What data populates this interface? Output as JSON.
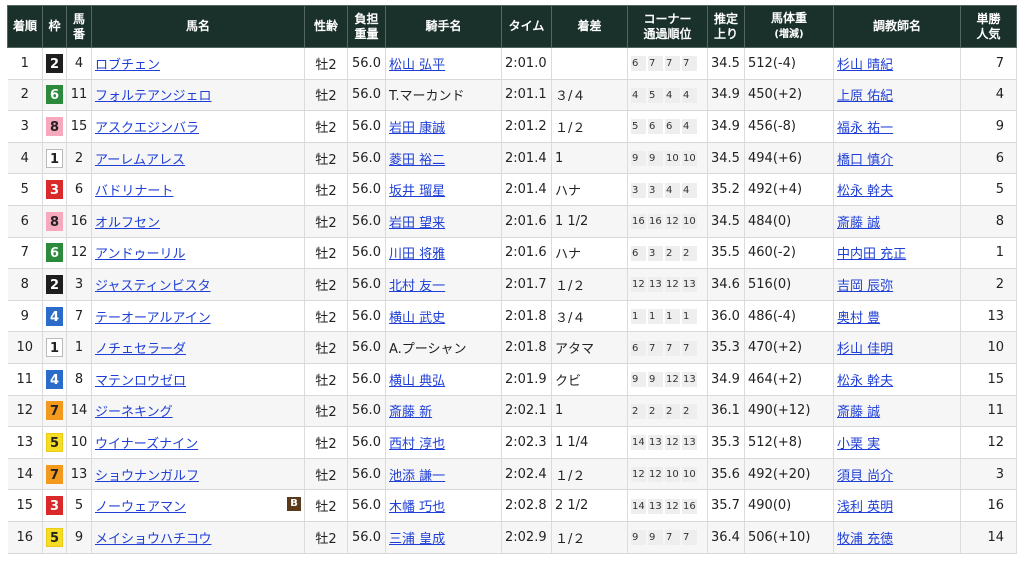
{
  "headers": {
    "rank": "着順",
    "waku": "枠",
    "umaban": [
      "馬",
      "番"
    ],
    "horse": "馬名",
    "sexage": "性齢",
    "weight": [
      "負担",
      "重量"
    ],
    "jockey": "騎手名",
    "time": "タイム",
    "margin": "着差",
    "corner": [
      "コーナー",
      "通過順位"
    ],
    "last3f": [
      "推定",
      "上り"
    ],
    "bodyweight": [
      "馬体重",
      "(増減)"
    ],
    "trainer": "調教師名",
    "pop": [
      "単勝",
      "人気"
    ]
  },
  "blinker_label": "B",
  "rows": [
    {
      "rank": "1",
      "waku": "2",
      "umaban": "4",
      "horse": "ロブチェン",
      "sexage": "牡2",
      "weight": "56.0",
      "jockey": "松山 弘平",
      "jockey_link": true,
      "time": "2:01.0",
      "margin": "",
      "corner": [
        "6",
        "7",
        "7",
        "7"
      ],
      "last3f": "34.5",
      "bodyweight": "512(-4)",
      "trainer": "杉山 晴紀",
      "pop": "7",
      "blinker": false
    },
    {
      "rank": "2",
      "waku": "6",
      "umaban": "11",
      "horse": "フォルテアンジェロ",
      "sexage": "牡2",
      "weight": "56.0",
      "jockey": "T.マーカンド",
      "jockey_link": false,
      "time": "2:01.1",
      "margin": "３/４",
      "corner": [
        "4",
        "5",
        "4",
        "4"
      ],
      "last3f": "34.9",
      "bodyweight": "450(+2)",
      "trainer": "上原 佑紀",
      "pop": "4",
      "blinker": false
    },
    {
      "rank": "3",
      "waku": "8",
      "umaban": "15",
      "horse": "アスクエジンバラ",
      "sexage": "牡2",
      "weight": "56.0",
      "jockey": "岩田 康誠",
      "jockey_link": true,
      "time": "2:01.2",
      "margin": "１/２",
      "corner": [
        "5",
        "6",
        "6",
        "4"
      ],
      "last3f": "34.9",
      "bodyweight": "456(-8)",
      "trainer": "福永 祐一",
      "pop": "9",
      "blinker": false
    },
    {
      "rank": "4",
      "waku": "1",
      "umaban": "2",
      "horse": "アーレムアレス",
      "sexage": "牡2",
      "weight": "56.0",
      "jockey": "菱田 裕二",
      "jockey_link": true,
      "time": "2:01.4",
      "margin": "1",
      "corner": [
        "9",
        "9",
        "10",
        "10"
      ],
      "last3f": "34.5",
      "bodyweight": "494(+6)",
      "trainer": "橋口 慎介",
      "pop": "6",
      "blinker": false
    },
    {
      "rank": "5",
      "waku": "3",
      "umaban": "6",
      "horse": "バドリナート",
      "sexage": "牡2",
      "weight": "56.0",
      "jockey": "坂井 瑠星",
      "jockey_link": true,
      "time": "2:01.4",
      "margin": "ハナ",
      "corner": [
        "3",
        "3",
        "4",
        "4"
      ],
      "last3f": "35.2",
      "bodyweight": "492(+4)",
      "trainer": "松永 幹夫",
      "pop": "5",
      "blinker": false
    },
    {
      "rank": "6",
      "waku": "8",
      "umaban": "16",
      "horse": "オルフセン",
      "sexage": "牡2",
      "weight": "56.0",
      "jockey": "岩田 望来",
      "jockey_link": true,
      "time": "2:01.6",
      "margin": "1 1/2",
      "corner": [
        "16",
        "16",
        "12",
        "10"
      ],
      "last3f": "34.5",
      "bodyweight": "484(0)",
      "trainer": "斎藤 誠",
      "pop": "8",
      "blinker": false
    },
    {
      "rank": "7",
      "waku": "6",
      "umaban": "12",
      "horse": "アンドゥーリル",
      "sexage": "牡2",
      "weight": "56.0",
      "jockey": "川田 将雅",
      "jockey_link": true,
      "time": "2:01.6",
      "margin": "ハナ",
      "corner": [
        "6",
        "3",
        "2",
        "2"
      ],
      "last3f": "35.5",
      "bodyweight": "460(-2)",
      "trainer": "中内田 充正",
      "pop": "1",
      "blinker": false
    },
    {
      "rank": "8",
      "waku": "2",
      "umaban": "3",
      "horse": "ジャスティンビスタ",
      "sexage": "牡2",
      "weight": "56.0",
      "jockey": "北村 友一",
      "jockey_link": true,
      "time": "2:01.7",
      "margin": "１/２",
      "corner": [
        "12",
        "13",
        "12",
        "13"
      ],
      "last3f": "34.6",
      "bodyweight": "516(0)",
      "trainer": "吉岡 辰弥",
      "pop": "2",
      "blinker": false
    },
    {
      "rank": "9",
      "waku": "4",
      "umaban": "7",
      "horse": "テーオーアルアイン",
      "sexage": "牡2",
      "weight": "56.0",
      "jockey": "横山 武史",
      "jockey_link": true,
      "time": "2:01.8",
      "margin": "３/４",
      "corner": [
        "1",
        "1",
        "1",
        "1"
      ],
      "last3f": "36.0",
      "bodyweight": "486(-4)",
      "trainer": "奥村 豊",
      "pop": "13",
      "blinker": false
    },
    {
      "rank": "10",
      "waku": "1",
      "umaban": "1",
      "horse": "ノチェセラーダ",
      "sexage": "牡2",
      "weight": "56.0",
      "jockey": "A.プーシャン",
      "jockey_link": false,
      "time": "2:01.8",
      "margin": "アタマ",
      "corner": [
        "6",
        "7",
        "7",
        "7"
      ],
      "last3f": "35.3",
      "bodyweight": "470(+2)",
      "trainer": "杉山 佳明",
      "pop": "10",
      "blinker": false
    },
    {
      "rank": "11",
      "waku": "4",
      "umaban": "8",
      "horse": "マテンロウゼロ",
      "sexage": "牡2",
      "weight": "56.0",
      "jockey": "横山 典弘",
      "jockey_link": true,
      "time": "2:01.9",
      "margin": "クビ",
      "corner": [
        "9",
        "9",
        "12",
        "13"
      ],
      "last3f": "34.9",
      "bodyweight": "464(+2)",
      "trainer": "松永 幹夫",
      "pop": "15",
      "blinker": false
    },
    {
      "rank": "12",
      "waku": "7",
      "umaban": "14",
      "horse": "ジーネキング",
      "sexage": "牡2",
      "weight": "56.0",
      "jockey": "斎藤 新",
      "jockey_link": true,
      "time": "2:02.1",
      "margin": "1",
      "corner": [
        "2",
        "2",
        "2",
        "2"
      ],
      "last3f": "36.1",
      "bodyweight": "490(+12)",
      "trainer": "斎藤 誠",
      "pop": "11",
      "blinker": false
    },
    {
      "rank": "13",
      "waku": "5",
      "umaban": "10",
      "horse": "ウイナーズナイン",
      "sexage": "牡2",
      "weight": "56.0",
      "jockey": "西村 淳也",
      "jockey_link": true,
      "time": "2:02.3",
      "margin": "1 1/4",
      "corner": [
        "14",
        "13",
        "12",
        "13"
      ],
      "last3f": "35.3",
      "bodyweight": "512(+8)",
      "trainer": "小栗 実",
      "pop": "12",
      "blinker": false
    },
    {
      "rank": "14",
      "waku": "7",
      "umaban": "13",
      "horse": "ショウナンガルフ",
      "sexage": "牡2",
      "weight": "56.0",
      "jockey": "池添 謙一",
      "jockey_link": true,
      "time": "2:02.4",
      "margin": "１/２",
      "corner": [
        "12",
        "12",
        "10",
        "10"
      ],
      "last3f": "35.6",
      "bodyweight": "492(+20)",
      "trainer": "須貝 尚介",
      "pop": "3",
      "blinker": false
    },
    {
      "rank": "15",
      "waku": "3",
      "umaban": "5",
      "horse": "ノーウェアマン",
      "sexage": "牡2",
      "weight": "56.0",
      "jockey": "木幡 巧也",
      "jockey_link": true,
      "time": "2:02.8",
      "margin": "2 1/2",
      "corner": [
        "14",
        "13",
        "12",
        "16"
      ],
      "last3f": "35.7",
      "bodyweight": "490(0)",
      "trainer": "浅利 英明",
      "pop": "16",
      "blinker": true
    },
    {
      "rank": "16",
      "waku": "5",
      "umaban": "9",
      "horse": "メイショウハチコウ",
      "sexage": "牡2",
      "weight": "56.0",
      "jockey": "三浦 皇成",
      "jockey_link": true,
      "time": "2:02.9",
      "margin": "１/２",
      "corner": [
        "9",
        "9",
        "7",
        "7"
      ],
      "last3f": "36.4",
      "bodyweight": "506(+10)",
      "trainer": "牧浦 充徳",
      "pop": "14",
      "blinker": false
    }
  ]
}
